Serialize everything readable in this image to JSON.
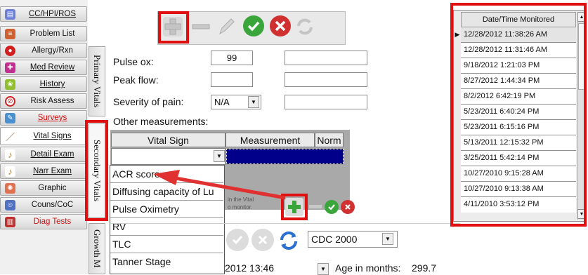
{
  "nav": {
    "items": [
      {
        "label": "CC/HPI/ROS",
        "icon": "clipboard-icon",
        "color": "#6a7fd8"
      },
      {
        "label": "Problem List",
        "icon": "list-icon",
        "color": "#d06030"
      },
      {
        "label": "Allergy/Rxn",
        "icon": "allergy-icon",
        "color": "#d22020"
      },
      {
        "label": "Med Review",
        "icon": "pill-icon",
        "color": "#c03090"
      },
      {
        "label": "History",
        "icon": "history-icon",
        "color": "#8fbf30"
      },
      {
        "label": "Risk Assess",
        "icon": "risk-icon",
        "color": "#d02020"
      },
      {
        "label": "Surveys",
        "icon": "survey-icon",
        "color": "#4a90d0"
      },
      {
        "label": "Vital Signs",
        "icon": "pen-icon",
        "color": "#8a5a30"
      },
      {
        "label": "Detail Exam",
        "icon": "exam-icon",
        "color": "#b08030"
      },
      {
        "label": "Narr Exam",
        "icon": "exam-icon",
        "color": "#b08030"
      },
      {
        "label": "Graphic",
        "icon": "graphic-icon",
        "color": "#e07050"
      },
      {
        "label": "Couns/CoC",
        "icon": "counsel-icon",
        "color": "#5070c0"
      },
      {
        "label": "Diag Tests",
        "icon": "tests-icon",
        "color": "#c03030"
      }
    ]
  },
  "tabs": {
    "primary": "Primary Vitals",
    "secondary": "Secondary Vitals",
    "growth": "Growth M"
  },
  "form": {
    "pulse_ox_label": "Pulse ox:",
    "pulse_ox_value": "99",
    "peak_flow_label": "Peak flow:",
    "pain_label": "Severity of pain:",
    "pain_value": "N/A",
    "other_label": "Other measurements:"
  },
  "grid": {
    "headers": [
      "Vital Sign",
      "Measurement",
      "Norm"
    ],
    "hint_line1": "in the Vital",
    "hint_line2": "o monitor."
  },
  "dropdown": {
    "options": [
      "ACR score",
      "Diffusing capacity of Lu",
      "Pulse Oximetry",
      "RV",
      "TLC",
      "Tanner Stage"
    ]
  },
  "bottom": {
    "chart_select": "CDC 2000",
    "date_value": "2012 13:46",
    "age_label": "Age in months:",
    "age_value": "299.7"
  },
  "history": {
    "header": "Date/Time Monitored",
    "rows": [
      "12/28/2012 11:38:26 AM",
      "12/28/2012 11:31:46 AM",
      "9/18/2012 1:21:03 PM",
      "8/27/2012 1:44:34 PM",
      "8/2/2012 6:42:19 PM",
      "5/23/2011 6:40:24 PM",
      "5/23/2011 6:15:16 PM",
      "5/13/2011 12:15:32 PM",
      "3/25/2011 5:42:14 PM",
      "10/27/2010 9:15:28 AM",
      "10/27/2010 9:13:38 AM",
      "4/11/2010 3:53:12 PM"
    ]
  },
  "colors": {
    "highlight": "#e01010",
    "selection": "#00008b",
    "ok_green": "#3aa53a",
    "cancel_red": "#d03030",
    "arrow_red": "#e03030"
  }
}
